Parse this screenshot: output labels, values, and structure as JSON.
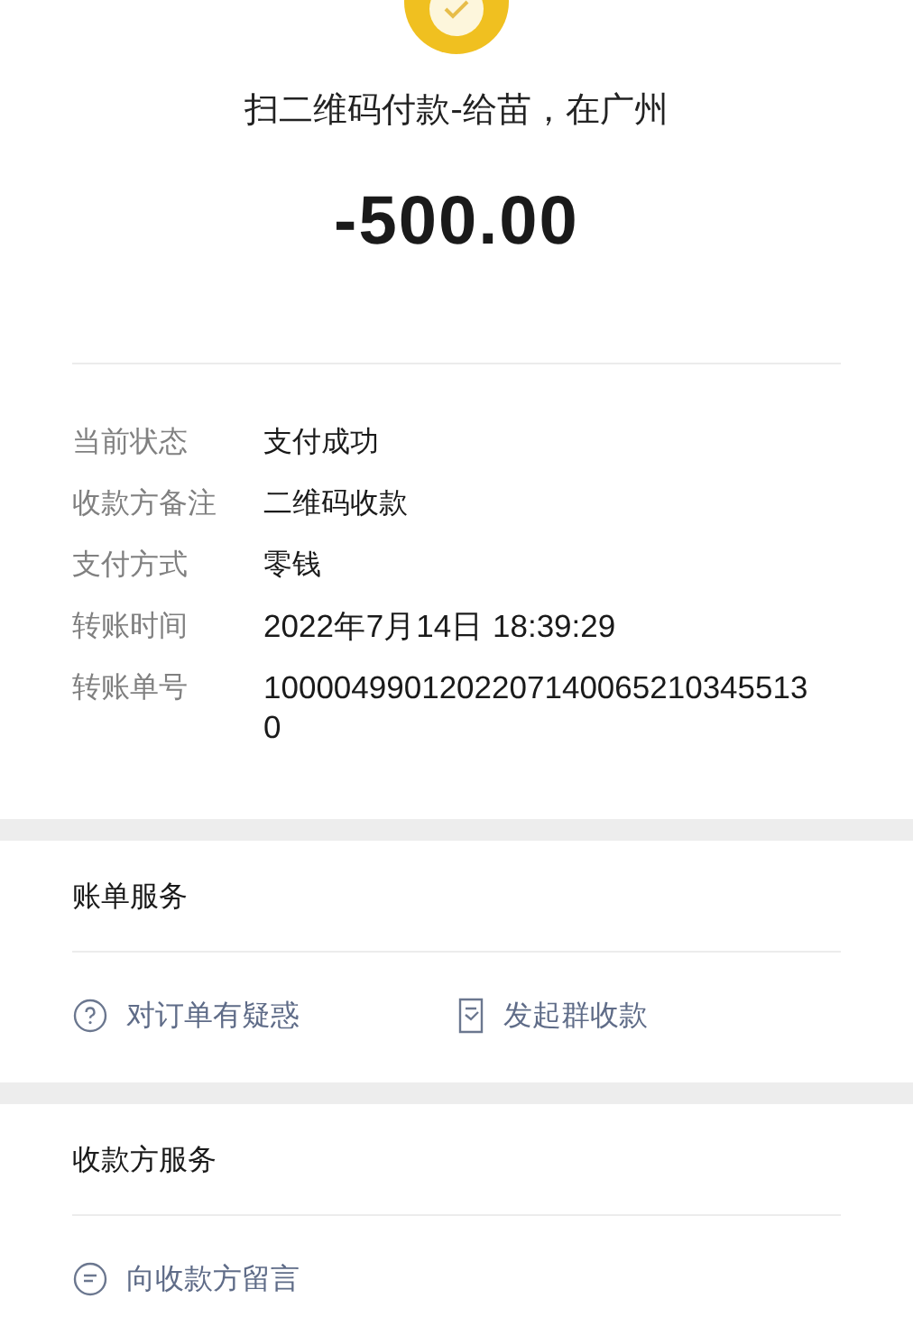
{
  "header": {
    "title": "扫二维码付款-给苗，在广州",
    "amount": "-500.00"
  },
  "details": [
    {
      "label": "当前状态",
      "value": "支付成功"
    },
    {
      "label": "收款方备注",
      "value": "二维码收款"
    },
    {
      "label": "支付方式",
      "value": "零钱"
    },
    {
      "label": "转账时间",
      "value": "2022年7月14日 18:39:29"
    },
    {
      "label": "转账单号",
      "value": "10000499012022071400652103455130"
    }
  ],
  "sections": [
    {
      "title": "账单服务",
      "actions": [
        {
          "kind": "question",
          "label": "对订单有疑惑"
        },
        {
          "kind": "receipt",
          "label": "发起群收款"
        }
      ]
    },
    {
      "title": "收款方服务",
      "actions": [
        {
          "kind": "message",
          "label": "向收款方留言"
        }
      ]
    }
  ]
}
